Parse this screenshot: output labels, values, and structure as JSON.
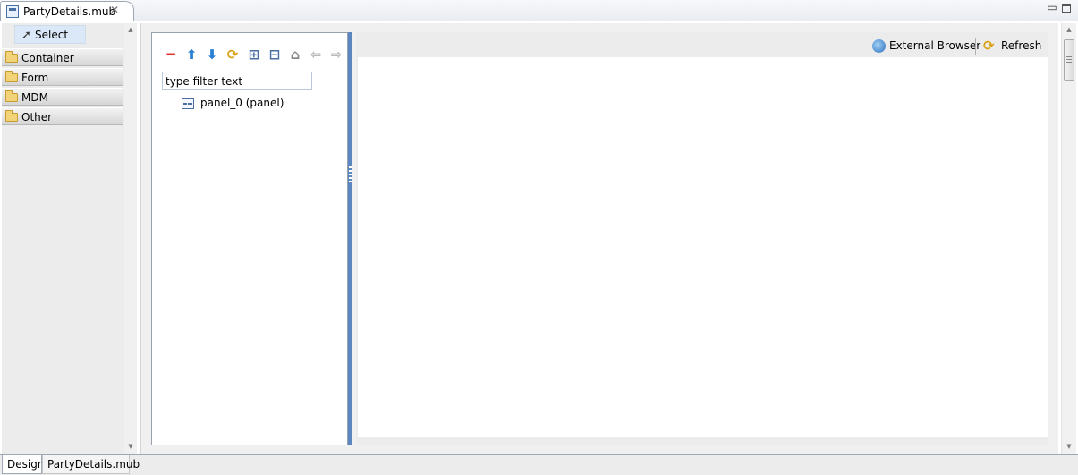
{
  "editor_tab": {
    "title": "PartyDetails.mub",
    "close_glyph": "✕"
  },
  "window_controls": {
    "minimize_glyph": "▭",
    "maximize": "maximize-icon"
  },
  "palette": {
    "select_label": "Select",
    "drawers": [
      {
        "label": "Container"
      },
      {
        "label": "Form"
      },
      {
        "label": "MDM"
      },
      {
        "label": "Other"
      }
    ]
  },
  "outline": {
    "toolbar": [
      {
        "name": "remove",
        "glyph": "━",
        "color": "#e03030"
      },
      {
        "name": "move-up",
        "glyph": "⬆",
        "color": "#2a7fd4"
      },
      {
        "name": "move-down",
        "glyph": "⬇",
        "color": "#2a7fd4"
      },
      {
        "name": "refresh",
        "glyph": "⟳",
        "color": "#d9a215"
      },
      {
        "name": "expand-all",
        "glyph": "⊞",
        "color": "#4a6fa5"
      },
      {
        "name": "collapse-all",
        "glyph": "⊟",
        "color": "#4a6fa5"
      },
      {
        "name": "home",
        "glyph": "⌂",
        "color": "#8a8a8a"
      },
      {
        "name": "back",
        "glyph": "⇦",
        "color": "#b8b8b8"
      },
      {
        "name": "forward",
        "glyph": "⇨",
        "color": "#b8b8b8"
      }
    ],
    "filter_placeholder": "type filter text",
    "filter_value": "type filter text",
    "tree": [
      {
        "label": "panel_0 (panel)",
        "icon": "panel-icon"
      }
    ]
  },
  "preview": {
    "external_browser_label": "External Browser",
    "refresh_label": "Refresh"
  },
  "bottom_tabs": [
    {
      "label": "Design"
    },
    {
      "label": "PartyDetails.mub"
    }
  ]
}
